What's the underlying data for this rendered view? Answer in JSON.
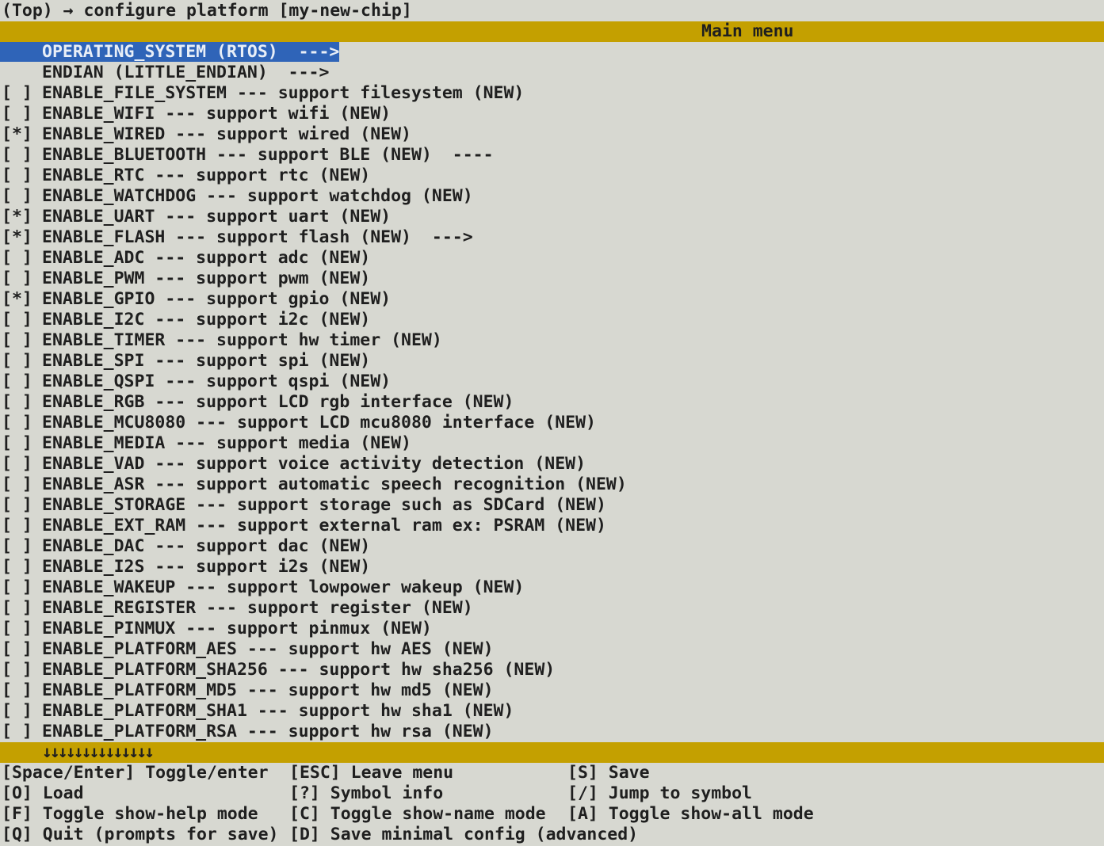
{
  "title": "(Top) → configure platform [my-new-chip]",
  "menu_title": "Main menu",
  "colors": {
    "background": "#d7d8d1",
    "bar": "#c4a000",
    "selection": "#2f64b8"
  },
  "items": [
    {
      "check": "",
      "text": "OPERATING_SYSTEM (RTOS)  --->",
      "selected": true
    },
    {
      "check": "",
      "text": "ENDIAN (LITTLE_ENDIAN)  --->"
    },
    {
      "check": "[ ]",
      "text": "ENABLE_FILE_SYSTEM --- support filesystem (NEW)"
    },
    {
      "check": "[ ]",
      "text": "ENABLE_WIFI --- support wifi (NEW)"
    },
    {
      "check": "[*]",
      "text": "ENABLE_WIRED --- support wired (NEW)"
    },
    {
      "check": "[ ]",
      "text": "ENABLE_BLUETOOTH --- support BLE (NEW)  ----"
    },
    {
      "check": "[ ]",
      "text": "ENABLE_RTC --- support rtc (NEW)"
    },
    {
      "check": "[ ]",
      "text": "ENABLE_WATCHDOG --- support watchdog (NEW)"
    },
    {
      "check": "[*]",
      "text": "ENABLE_UART --- support uart (NEW)"
    },
    {
      "check": "[*]",
      "text": "ENABLE_FLASH --- support flash (NEW)  --->"
    },
    {
      "check": "[ ]",
      "text": "ENABLE_ADC --- support adc (NEW)"
    },
    {
      "check": "[ ]",
      "text": "ENABLE_PWM --- support pwm (NEW)"
    },
    {
      "check": "[*]",
      "text": "ENABLE_GPIO --- support gpio (NEW)"
    },
    {
      "check": "[ ]",
      "text": "ENABLE_I2C --- support i2c (NEW)"
    },
    {
      "check": "[ ]",
      "text": "ENABLE_TIMER --- support hw timer (NEW)"
    },
    {
      "check": "[ ]",
      "text": "ENABLE_SPI --- support spi (NEW)"
    },
    {
      "check": "[ ]",
      "text": "ENABLE_QSPI --- support qspi (NEW)"
    },
    {
      "check": "[ ]",
      "text": "ENABLE_RGB --- support LCD rgb interface (NEW)"
    },
    {
      "check": "[ ]",
      "text": "ENABLE_MCU8080 --- support LCD mcu8080 interface (NEW)"
    },
    {
      "check": "[ ]",
      "text": "ENABLE_MEDIA --- support media (NEW)"
    },
    {
      "check": "[ ]",
      "text": "ENABLE_VAD --- support voice activity detection (NEW)"
    },
    {
      "check": "[ ]",
      "text": "ENABLE_ASR --- support automatic speech recognition (NEW)"
    },
    {
      "check": "[ ]",
      "text": "ENABLE_STORAGE --- support storage such as SDCard (NEW)"
    },
    {
      "check": "[ ]",
      "text": "ENABLE_EXT_RAM --- support external ram ex: PSRAM (NEW)"
    },
    {
      "check": "[ ]",
      "text": "ENABLE_DAC --- support dac (NEW)"
    },
    {
      "check": "[ ]",
      "text": "ENABLE_I2S --- support i2s (NEW)"
    },
    {
      "check": "[ ]",
      "text": "ENABLE_WAKEUP --- support lowpower wakeup (NEW)"
    },
    {
      "check": "[ ]",
      "text": "ENABLE_REGISTER --- support register (NEW)"
    },
    {
      "check": "[ ]",
      "text": "ENABLE_PINMUX --- support pinmux (NEW)"
    },
    {
      "check": "[ ]",
      "text": "ENABLE_PLATFORM_AES --- support hw AES (NEW)"
    },
    {
      "check": "[ ]",
      "text": "ENABLE_PLATFORM_SHA256 --- support hw sha256 (NEW)"
    },
    {
      "check": "[ ]",
      "text": "ENABLE_PLATFORM_MD5 --- support hw md5 (NEW)"
    },
    {
      "check": "[ ]",
      "text": "ENABLE_PLATFORM_SHA1 --- support hw sha1 (NEW)"
    },
    {
      "check": "[ ]",
      "text": "ENABLE_PLATFORM_RSA --- support hw rsa (NEW)"
    }
  ],
  "scroll_indicator": "↓↓↓↓↓↓↓↓↓↓↓↓↓↓",
  "help": {
    "space_enter": "[Space/Enter] Toggle/enter",
    "esc": "[ESC] Leave menu",
    "save": "[S] Save",
    "load": "[O] Load",
    "symbol_info": "[?] Symbol info",
    "jump": "[/] Jump to symbol",
    "show_help": "[F] Toggle show-help mode",
    "show_name": "[C] Toggle show-name mode",
    "show_all": "[A] Toggle show-all mode",
    "quit": "[Q] Quit (prompts for save)",
    "save_minimal": "[D] Save minimal config (advanced)"
  }
}
